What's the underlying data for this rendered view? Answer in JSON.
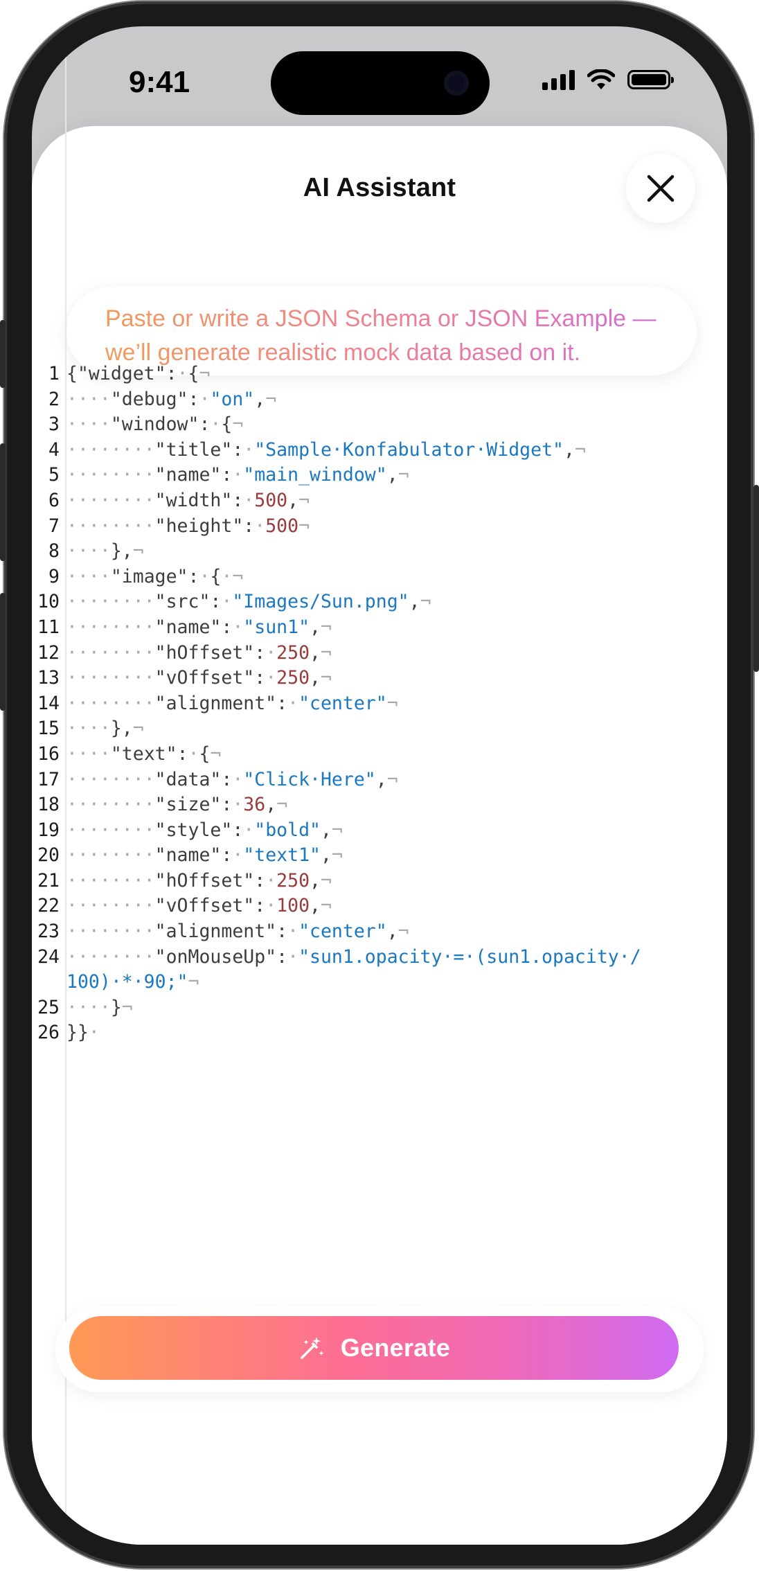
{
  "status_bar": {
    "time": "9:41"
  },
  "sheet": {
    "title": "AI Assistant",
    "hint": "Paste or write a JSON Schema or JSON Example — we’ll generate realistic mock data based on it."
  },
  "editor": {
    "lines": [
      {
        "n": "1",
        "tokens": [
          [
            "p",
            "{\"widget\":"
          ],
          [
            "w",
            "·"
          ],
          [
            "p",
            "{"
          ],
          [
            "e",
            "¬"
          ]
        ]
      },
      {
        "n": "2",
        "tokens": [
          [
            "w",
            "····"
          ],
          [
            "p",
            "\"debug\":"
          ],
          [
            "w",
            "·"
          ],
          [
            "s",
            "\"on\""
          ],
          [
            "p",
            ","
          ],
          [
            "e",
            "¬"
          ]
        ]
      },
      {
        "n": "3",
        "tokens": [
          [
            "w",
            "····"
          ],
          [
            "p",
            "\"window\":"
          ],
          [
            "w",
            "·"
          ],
          [
            "p",
            "{"
          ],
          [
            "e",
            "¬"
          ]
        ]
      },
      {
        "n": "4",
        "tokens": [
          [
            "w",
            "········"
          ],
          [
            "p",
            "\"title\":"
          ],
          [
            "w",
            "·"
          ],
          [
            "s",
            "\"Sample·Konfabulator·Widget\""
          ],
          [
            "p",
            ","
          ],
          [
            "e",
            "¬"
          ]
        ]
      },
      {
        "n": "5",
        "tokens": [
          [
            "w",
            "········"
          ],
          [
            "p",
            "\"name\":"
          ],
          [
            "w",
            "·"
          ],
          [
            "s",
            "\"main_window\""
          ],
          [
            "p",
            ","
          ],
          [
            "e",
            "¬"
          ]
        ]
      },
      {
        "n": "6",
        "tokens": [
          [
            "w",
            "········"
          ],
          [
            "p",
            "\"width\":"
          ],
          [
            "w",
            "·"
          ],
          [
            "d",
            "500"
          ],
          [
            "p",
            ","
          ],
          [
            "e",
            "¬"
          ]
        ]
      },
      {
        "n": "7",
        "tokens": [
          [
            "w",
            "········"
          ],
          [
            "p",
            "\"height\":"
          ],
          [
            "w",
            "·"
          ],
          [
            "d",
            "500"
          ],
          [
            "e",
            "¬"
          ]
        ]
      },
      {
        "n": "8",
        "tokens": [
          [
            "w",
            "····"
          ],
          [
            "p",
            "},"
          ],
          [
            "e",
            "¬"
          ]
        ]
      },
      {
        "n": "9",
        "tokens": [
          [
            "w",
            "····"
          ],
          [
            "p",
            "\"image\":"
          ],
          [
            "w",
            "·"
          ],
          [
            "p",
            "{"
          ],
          [
            "w",
            "·"
          ],
          [
            "e",
            "¬"
          ]
        ]
      },
      {
        "n": "10",
        "tokens": [
          [
            "w",
            "········"
          ],
          [
            "p",
            "\"src\":"
          ],
          [
            "w",
            "·"
          ],
          [
            "s",
            "\"Images/Sun.png\""
          ],
          [
            "p",
            ","
          ],
          [
            "e",
            "¬"
          ]
        ]
      },
      {
        "n": "11",
        "tokens": [
          [
            "w",
            "········"
          ],
          [
            "p",
            "\"name\":"
          ],
          [
            "w",
            "·"
          ],
          [
            "s",
            "\"sun1\""
          ],
          [
            "p",
            ","
          ],
          [
            "e",
            "¬"
          ]
        ]
      },
      {
        "n": "12",
        "tokens": [
          [
            "w",
            "········"
          ],
          [
            "p",
            "\"hOffset\":"
          ],
          [
            "w",
            "·"
          ],
          [
            "d",
            "250"
          ],
          [
            "p",
            ","
          ],
          [
            "e",
            "¬"
          ]
        ]
      },
      {
        "n": "13",
        "tokens": [
          [
            "w",
            "········"
          ],
          [
            "p",
            "\"vOffset\":"
          ],
          [
            "w",
            "·"
          ],
          [
            "d",
            "250"
          ],
          [
            "p",
            ","
          ],
          [
            "e",
            "¬"
          ]
        ]
      },
      {
        "n": "14",
        "tokens": [
          [
            "w",
            "········"
          ],
          [
            "p",
            "\"alignment\":"
          ],
          [
            "w",
            "·"
          ],
          [
            "s",
            "\"center\""
          ],
          [
            "e",
            "¬"
          ]
        ]
      },
      {
        "n": "15",
        "tokens": [
          [
            "w",
            "····"
          ],
          [
            "p",
            "},"
          ],
          [
            "e",
            "¬"
          ]
        ]
      },
      {
        "n": "16",
        "tokens": [
          [
            "w",
            "····"
          ],
          [
            "p",
            "\"text\":"
          ],
          [
            "w",
            "·"
          ],
          [
            "p",
            "{"
          ],
          [
            "e",
            "¬"
          ]
        ]
      },
      {
        "n": "17",
        "tokens": [
          [
            "w",
            "········"
          ],
          [
            "p",
            "\"data\":"
          ],
          [
            "w",
            "·"
          ],
          [
            "s",
            "\"Click·Here\""
          ],
          [
            "p",
            ","
          ],
          [
            "e",
            "¬"
          ]
        ]
      },
      {
        "n": "18",
        "tokens": [
          [
            "w",
            "········"
          ],
          [
            "p",
            "\"size\":"
          ],
          [
            "w",
            "·"
          ],
          [
            "d",
            "36"
          ],
          [
            "p",
            ","
          ],
          [
            "e",
            "¬"
          ]
        ]
      },
      {
        "n": "19",
        "tokens": [
          [
            "w",
            "········"
          ],
          [
            "p",
            "\"style\":"
          ],
          [
            "w",
            "·"
          ],
          [
            "s",
            "\"bold\""
          ],
          [
            "p",
            ","
          ],
          [
            "e",
            "¬"
          ]
        ]
      },
      {
        "n": "20",
        "tokens": [
          [
            "w",
            "········"
          ],
          [
            "p",
            "\"name\":"
          ],
          [
            "w",
            "·"
          ],
          [
            "s",
            "\"text1\""
          ],
          [
            "p",
            ","
          ],
          [
            "e",
            "¬"
          ]
        ]
      },
      {
        "n": "21",
        "tokens": [
          [
            "w",
            "········"
          ],
          [
            "p",
            "\"hOffset\":"
          ],
          [
            "w",
            "·"
          ],
          [
            "d",
            "250"
          ],
          [
            "p",
            ","
          ],
          [
            "e",
            "¬"
          ]
        ]
      },
      {
        "n": "22",
        "tokens": [
          [
            "w",
            "········"
          ],
          [
            "p",
            "\"vOffset\":"
          ],
          [
            "w",
            "·"
          ],
          [
            "d",
            "100"
          ],
          [
            "p",
            ","
          ],
          [
            "e",
            "¬"
          ]
        ]
      },
      {
        "n": "23",
        "tokens": [
          [
            "w",
            "········"
          ],
          [
            "p",
            "\"alignment\":"
          ],
          [
            "w",
            "·"
          ],
          [
            "s",
            "\"center\""
          ],
          [
            "p",
            ","
          ],
          [
            "e",
            "¬"
          ]
        ]
      },
      {
        "n": "24",
        "tokens": [
          [
            "w",
            "········"
          ],
          [
            "p",
            "\"onMouseUp\":"
          ],
          [
            "w",
            "·"
          ],
          [
            "s",
            "\"sun1.opacity·=·(sun1.opacity·/"
          ]
        ]
      },
      {
        "n": "",
        "tokens": [
          [
            "s",
            "100)·*·90;\""
          ],
          [
            "e",
            "¬"
          ]
        ]
      },
      {
        "n": "25",
        "tokens": [
          [
            "w",
            "····"
          ],
          [
            "p",
            "}"
          ],
          [
            "e",
            "¬"
          ]
        ]
      },
      {
        "n": "26",
        "tokens": [
          [
            "p",
            "}}"
          ],
          [
            "w",
            "·"
          ]
        ]
      }
    ]
  },
  "generate_button": {
    "label": "Generate"
  },
  "icons": {
    "close": "close-icon",
    "generate": "magic-wand-icon",
    "wifi": "wifi-icon",
    "signal": "cellular-signal-icon",
    "battery": "battery-icon"
  },
  "colors": {
    "string": "#1a78c2",
    "number": "#9a3b3b",
    "accent_start": "#ff9a55",
    "accent_end": "#cf6af0"
  }
}
